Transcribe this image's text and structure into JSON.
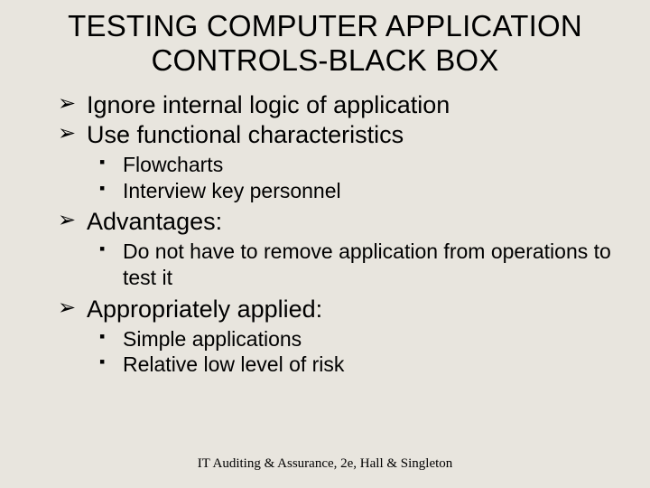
{
  "title_line1": "TESTING COMPUTER APPLICATION",
  "title_line2": "CONTROLS-BLACK BOX",
  "bullets": {
    "b1": "Ignore internal logic of application",
    "b2": "Use functional characteristics",
    "b2_sub1": "Flowcharts",
    "b2_sub2": "Interview key personnel",
    "b3": "Advantages:",
    "b3_sub1": "Do not have to remove application from operations to test it",
    "b4": "Appropriately applied:",
    "b4_sub1": "Simple applications",
    "b4_sub2": "Relative low level of risk"
  },
  "footer": "IT Auditing & Assurance, 2e, Hall & Singleton"
}
